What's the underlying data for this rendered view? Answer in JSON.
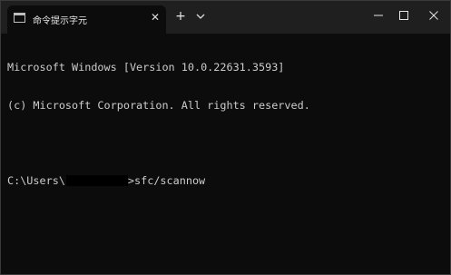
{
  "window": {
    "tab_title": "命令提示字元",
    "tab_icon": "terminal-icon",
    "new_tab_symbol": "+",
    "close_tab_symbol": "✕"
  },
  "terminal": {
    "line1": "Microsoft Windows [Version 10.0.22631.3593]",
    "line2": "(c) Microsoft Corporation. All rights reserved.",
    "prompt_prefix": "C:\\Users\\",
    "prompt_suffix": ">sfc/scannow"
  },
  "colors": {
    "background": "#0c0c0c",
    "titlebar": "#1f1f1f",
    "text": "#cccccc"
  }
}
